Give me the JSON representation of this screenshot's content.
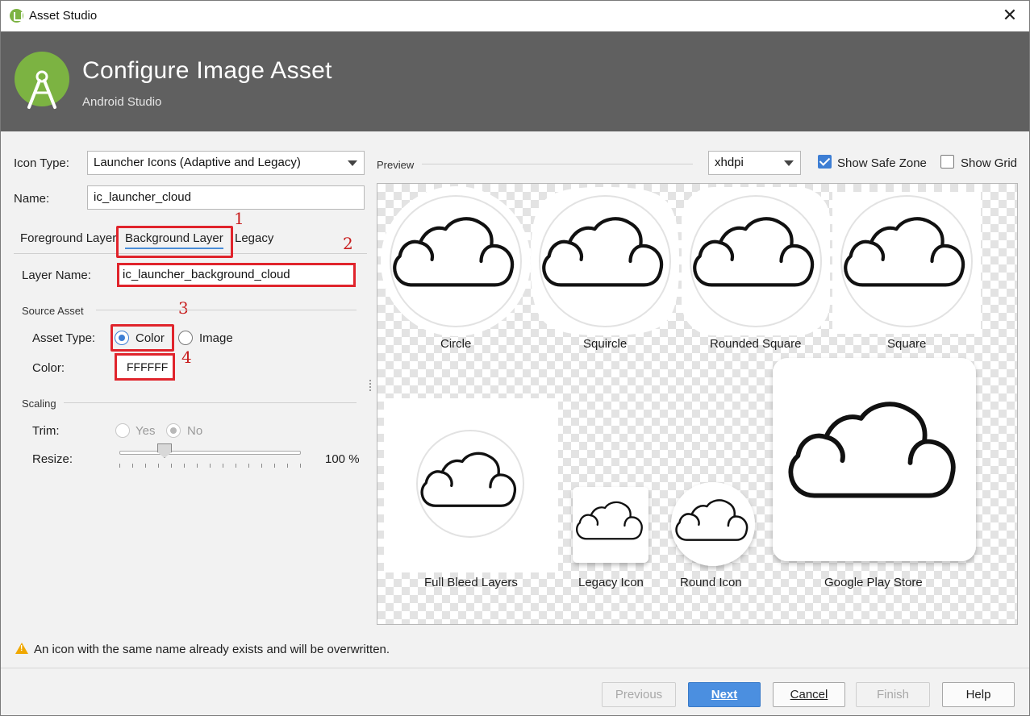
{
  "window": {
    "title": "Asset Studio",
    "close_glyph": "✕"
  },
  "header": {
    "title": "Configure Image Asset",
    "subtitle": "Android Studio"
  },
  "form": {
    "icon_type_label": "Icon Type:",
    "icon_type_value": "Launcher Icons (Adaptive and Legacy)",
    "name_label": "Name:",
    "name_value": "ic_launcher_cloud"
  },
  "tabs": [
    {
      "label": "Foreground Layer"
    },
    {
      "label": "Background Layer",
      "active": true
    },
    {
      "label": "Legacy"
    }
  ],
  "layer": {
    "layer_name_label": "Layer Name:",
    "layer_name_value": "ic_launcher_background_cloud",
    "source_asset_label": "Source Asset",
    "asset_type_label": "Asset Type:",
    "asset_type_options": [
      "Color",
      "Image"
    ],
    "asset_type_selected": "Color",
    "color_label": "Color:",
    "color_value": "FFFFFF"
  },
  "scaling": {
    "section_label": "Scaling",
    "trim_label": "Trim:",
    "trim_options": [
      "Yes",
      "No"
    ],
    "trim_selected": "No",
    "resize_label": "Resize:",
    "resize_value": "100 %"
  },
  "annotations": [
    "1",
    "2",
    "3",
    "4"
  ],
  "preview": {
    "label": "Preview",
    "density": "xhdpi",
    "show_safe_zone_label": "Show Safe Zone",
    "show_safe_zone": true,
    "show_grid_label": "Show Grid",
    "show_grid": false,
    "items": [
      "Circle",
      "Squircle",
      "Rounded Square",
      "Square",
      "Full Bleed Layers",
      "Legacy Icon",
      "Round Icon",
      "Google Play Store"
    ]
  },
  "warning": "An icon with the same name already exists and will be overwritten.",
  "buttons": {
    "previous": "Previous",
    "next": "Next",
    "cancel": "Cancel",
    "finish": "Finish",
    "help": "Help"
  },
  "colors": {
    "accent": "#4b8fe0",
    "annotation": "#e0242c",
    "header_bg": "#606060",
    "brand": "#7cb342"
  }
}
